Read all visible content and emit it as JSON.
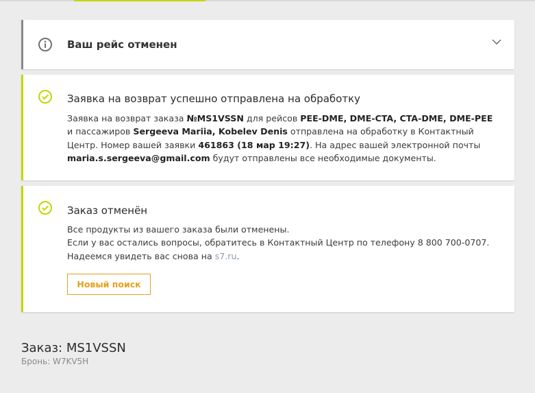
{
  "cancel_notice": {
    "title": "Ваш рейс отменен"
  },
  "refund_notice": {
    "title": "Заявка на возврат успешно отправлена на обработку",
    "p1": "Заявка на возврат заказа ",
    "order_no": "№MS1VSSN",
    "p2": " для рейсов ",
    "flights": "PEE-DME, DME-CTA, CTA-DME, DME-PEE",
    "p3": " и пассажиров ",
    "passengers": "Sergeeva Mariia, Kobelev Denis",
    "p4": " отправлена на обработку в Контактный Центр. Номер вашей заявки ",
    "request_no": "461863 (18 мар 19:27)",
    "p5": ". На адрес вашей электронной почты ",
    "email": "maria.s.sergeeva@gmail.com",
    "p6": " будут отправлены все необходимые документы."
  },
  "order_cancelled": {
    "title": "Заказ отменён",
    "line1": "Все продукты из вашего заказа были отменены.",
    "line2": "Если у вас остались вопросы, обратитесь в Контактный Центр по телефону 8 800 700-0707.",
    "line3_prefix": "Надеемся увидеть вас снова на ",
    "site_link": "s7.ru",
    "line3_suffix": ".",
    "new_search_button": "Новый поиск"
  },
  "order_summary": {
    "order_label": "Заказ: MS1VSSN",
    "booking_label": "Бронь: W7KV5H"
  },
  "colors": {
    "accent_green": "#c4d600",
    "accent_gray": "#8a8a8a",
    "button_orange": "#e5a11c"
  },
  "icons": {
    "cancel_notice": "info-icon",
    "refund_notice": "check-circle-icon",
    "order_cancelled": "check-circle-icon",
    "expand": "chevron-down-icon"
  }
}
